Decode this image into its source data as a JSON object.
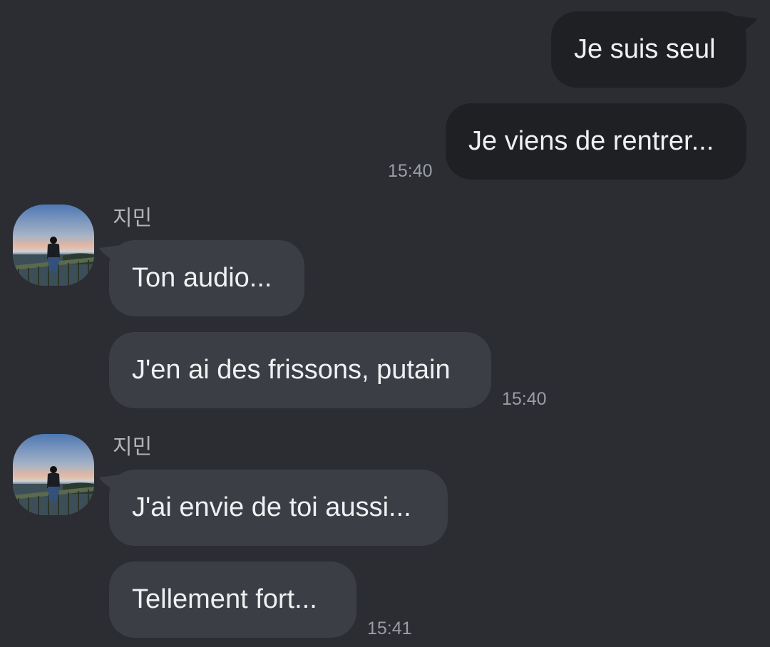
{
  "colors": {
    "background": "#2b2d33",
    "sent_bubble": "#1f2024",
    "received_bubble": "#3b3e44",
    "text": "#eef0f2",
    "timestamp": "#9a9da3",
    "sender_name": "#b0b3b8"
  },
  "messages": {
    "sent_group": {
      "items": [
        {
          "text": "Je suis seul"
        },
        {
          "text": "Je viens de rentrer..."
        }
      ],
      "time": "15:40"
    },
    "received_group_1": {
      "sender": "지민",
      "avatar_icon": "profile-photo-sunset-person-icon",
      "items": [
        {
          "text": "Ton audio..."
        },
        {
          "text": "J'en ai des frissons, putain"
        }
      ],
      "time": "15:40"
    },
    "received_group_2": {
      "sender": "지민",
      "avatar_icon": "profile-photo-sunset-person-icon",
      "items": [
        {
          "text": "J'ai envie de toi aussi..."
        },
        {
          "text": "Tellement fort..."
        }
      ],
      "time": "15:41"
    }
  }
}
